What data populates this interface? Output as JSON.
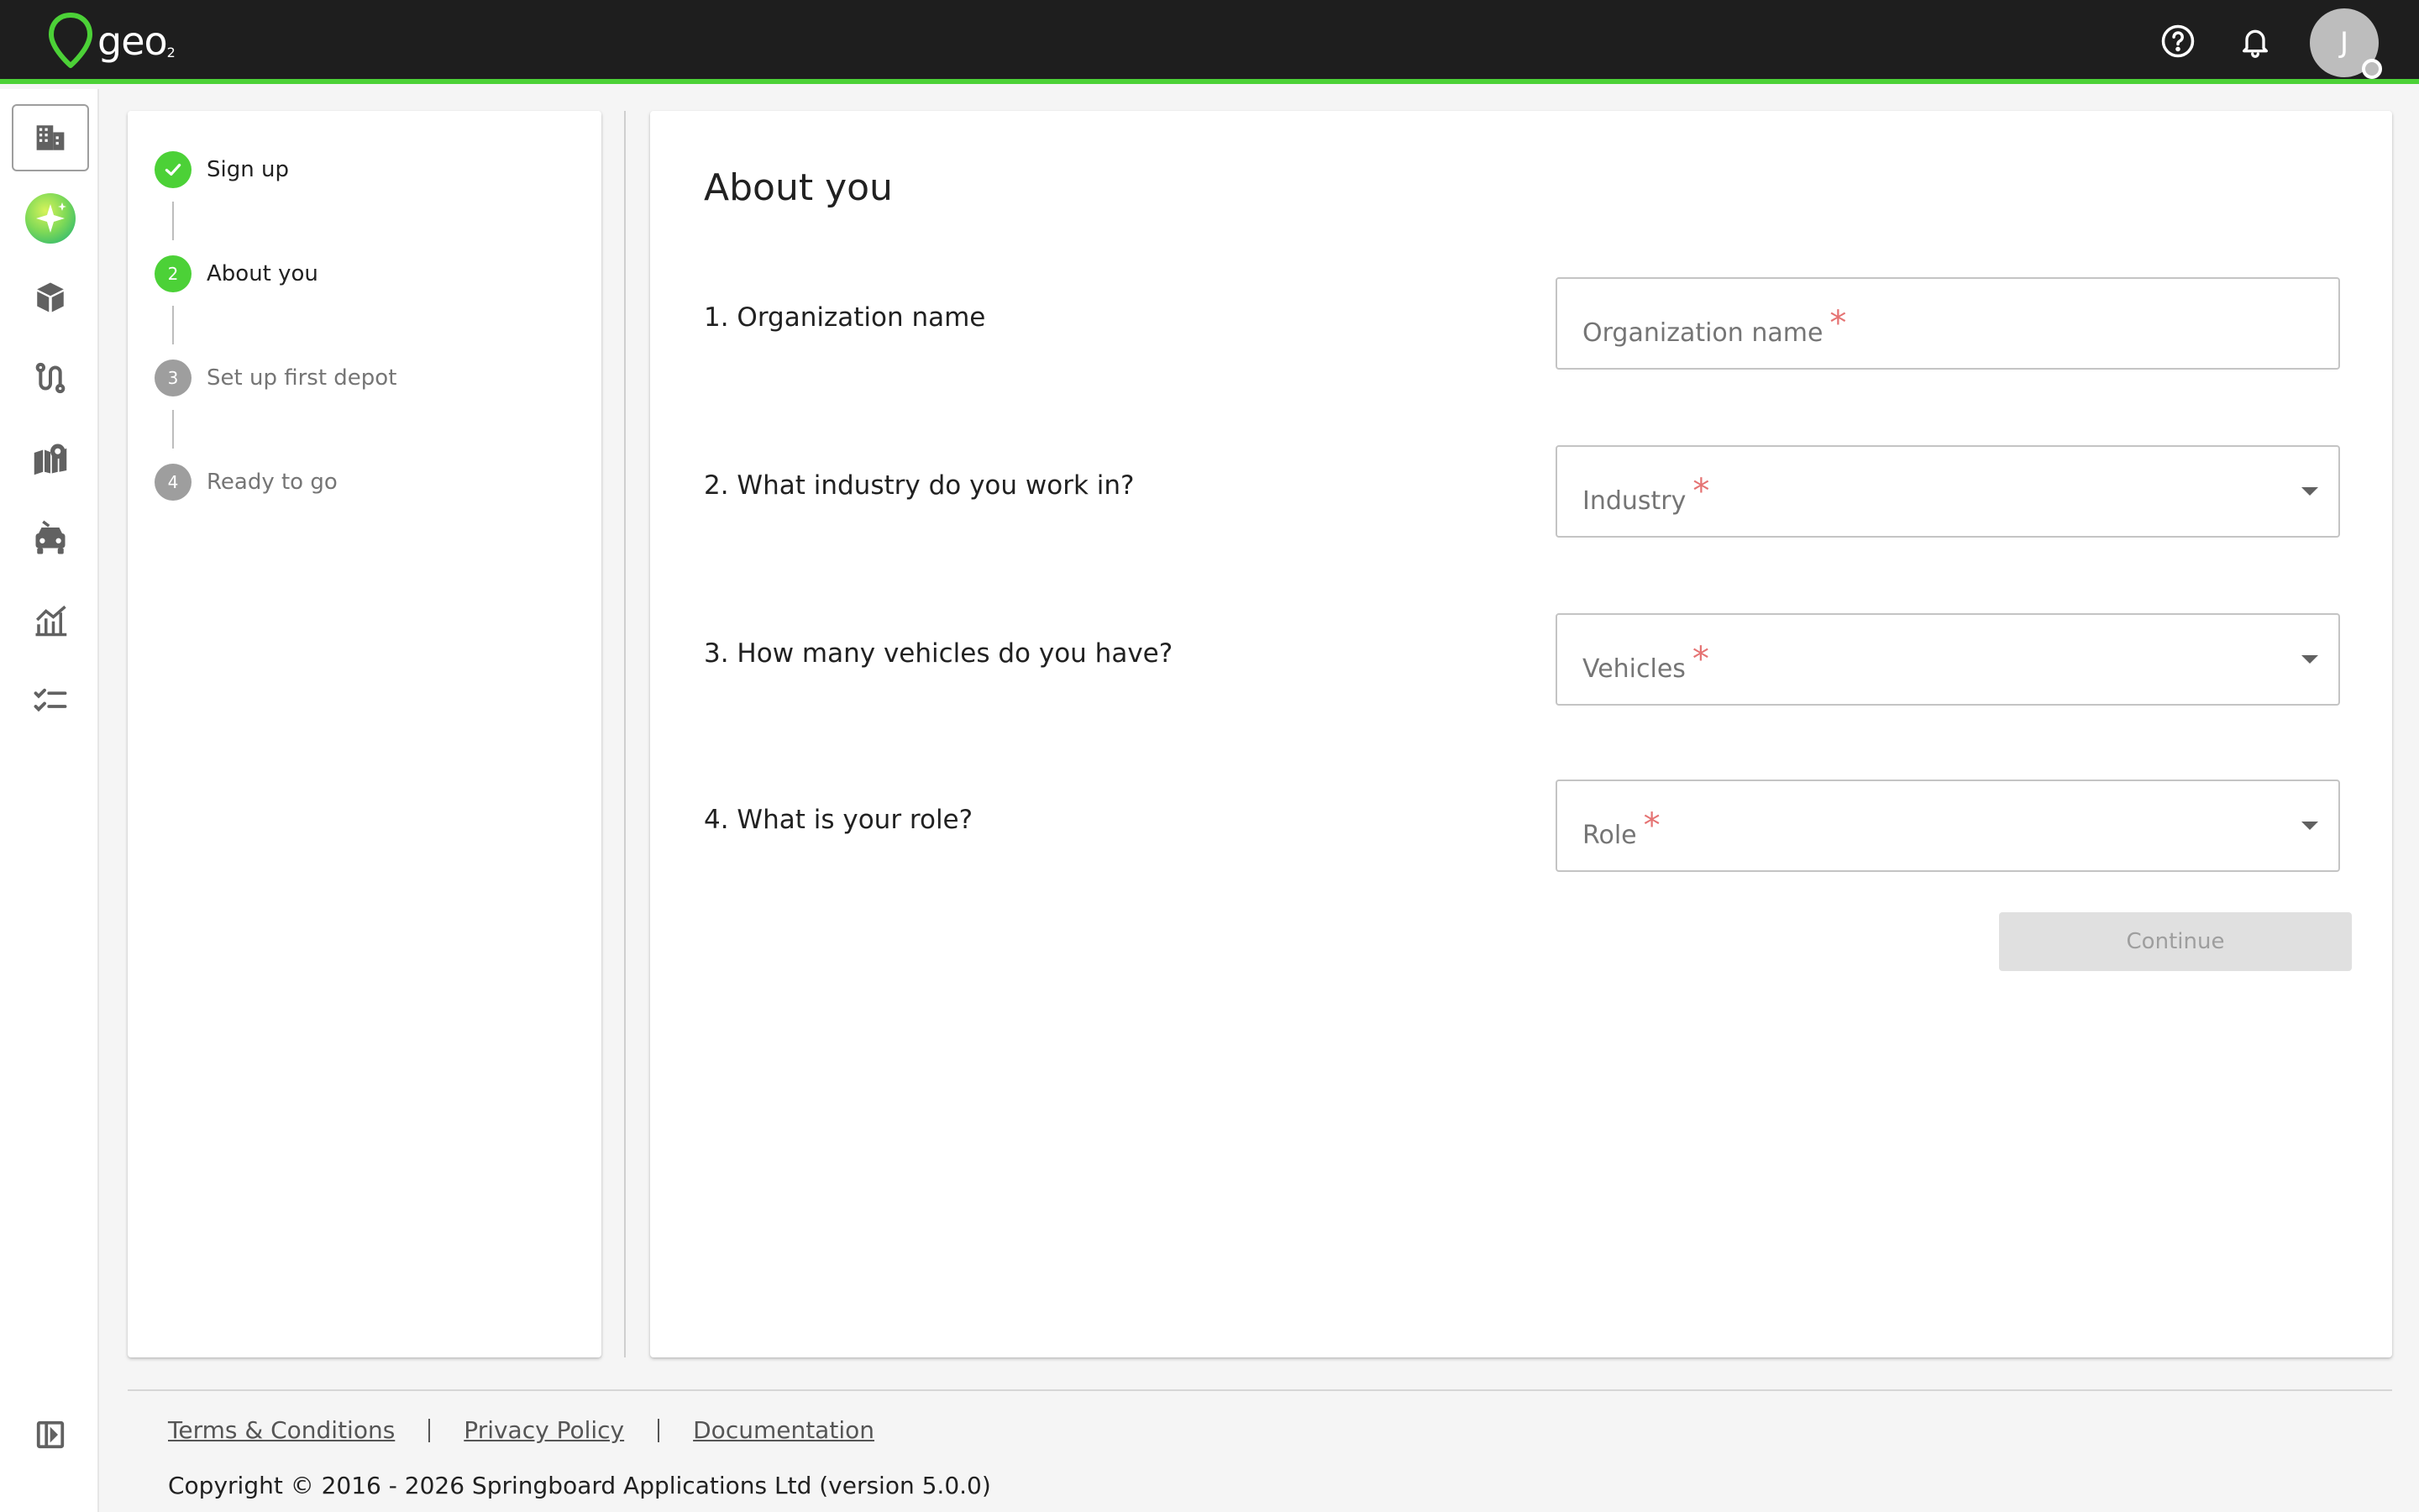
{
  "header": {
    "logo_text": "geo",
    "logo_sub": "2",
    "avatar_initial": "J",
    "accent_color": "#4cd137",
    "icons": [
      "help-circle-icon",
      "bell-icon"
    ]
  },
  "rail": {
    "items": [
      "building-icon",
      "sparkle-icon",
      "box-icon",
      "route-icon",
      "map-pin-icon",
      "vehicle-icon",
      "analytics-icon",
      "checklist-icon",
      "collapse-panel-icon"
    ]
  },
  "stepper": {
    "steps": [
      {
        "label": "Sign up",
        "number": "",
        "state": "done"
      },
      {
        "label": "About you",
        "number": "2",
        "state": "current"
      },
      {
        "label": "Set up first depot",
        "number": "3",
        "state": "pending"
      },
      {
        "label": "Ready to go",
        "number": "4",
        "state": "pending"
      }
    ]
  },
  "form": {
    "title": "About you",
    "questions": [
      {
        "question": "1. Organization name",
        "field_label": "Organization name",
        "type": "text"
      },
      {
        "question": "2. What industry do you work in?",
        "field_label": "Industry",
        "type": "select"
      },
      {
        "question": "3. How many vehicles do you have?",
        "field_label": "Vehicles",
        "type": "select"
      },
      {
        "question": "4. What is your role?",
        "field_label": "Role",
        "type": "select"
      }
    ],
    "required_marker": "*",
    "continue_label": "Continue"
  },
  "footer": {
    "links": [
      "Terms & Conditions",
      "Privacy Policy",
      "Documentation"
    ],
    "copyright": "Copyright © 2016 - 2026 Springboard Applications Ltd (version 5.0.0)"
  }
}
